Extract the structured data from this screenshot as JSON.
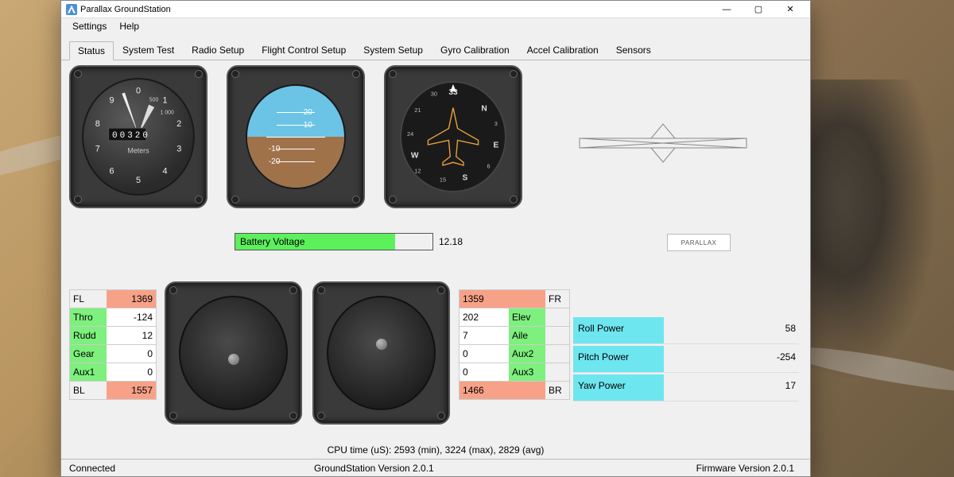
{
  "window": {
    "title": "Parallax GroundStation"
  },
  "menu": {
    "settings": "Settings",
    "help": "Help"
  },
  "tabs": {
    "status": "Status",
    "system_test": "System Test",
    "radio_setup": "Radio Setup",
    "flight_control_setup": "Flight Control Setup",
    "system_setup": "System Setup",
    "gyro_calibration": "Gyro Calibration",
    "accel_calibration": "Accel Calibration",
    "sensors": "Sensors"
  },
  "altimeter": {
    "unit": "Meters",
    "scale_500": "500",
    "scale_1000": "1 000",
    "counter": "00320",
    "ticks": [
      "0",
      "1",
      "2",
      "3",
      "4",
      "5",
      "6",
      "7",
      "8",
      "9"
    ]
  },
  "attitude": {
    "p10": "10",
    "p20": "20",
    "m10": "-10",
    "m20": "-20"
  },
  "compass": {
    "heading": "33",
    "N": "N",
    "E": "E",
    "S": "S",
    "W": "W",
    "t30": "30",
    "t33": "33",
    "t3": "3",
    "t6": "6",
    "t12": "12",
    "t15": "15",
    "t21": "21",
    "t24": "24"
  },
  "battery": {
    "label": "Battery Voltage",
    "value": "12.18"
  },
  "parallax_badge": "PARALLAX",
  "left_channels": {
    "fl_lab": "FL",
    "fl_val": "1369",
    "thro_lab": "Thro",
    "thro_val": "-124",
    "rudd_lab": "Rudd",
    "rudd_val": "12",
    "gear_lab": "Gear",
    "gear_val": "0",
    "aux1_lab": "Aux1",
    "aux1_val": "0",
    "bl_lab": "BL",
    "bl_val": "1557"
  },
  "right_channels": {
    "fr_lab": "FR",
    "fr_val": "1359",
    "elev_lab": "Elev",
    "elev_val": "202",
    "aile_lab": "Aile",
    "aile_val": "7",
    "aux2_lab": "Aux2",
    "aux2_val": "0",
    "aux3_lab": "Aux3",
    "aux3_val": "0",
    "br_lab": "BR",
    "br_val": "1466"
  },
  "power": {
    "roll_lab": "Roll Power",
    "roll_val": "58",
    "pitch_lab": "Pitch Power",
    "pitch_val": "-254",
    "yaw_lab": "Yaw Power",
    "yaw_val": "17"
  },
  "cpu": "CPU time (uS): 2593 (min), 3224 (max), 2829 (avg)",
  "status": {
    "connected": "Connected",
    "gs_version": "GroundStation Version 2.0.1",
    "fw_version": "Firmware Version 2.0.1"
  }
}
